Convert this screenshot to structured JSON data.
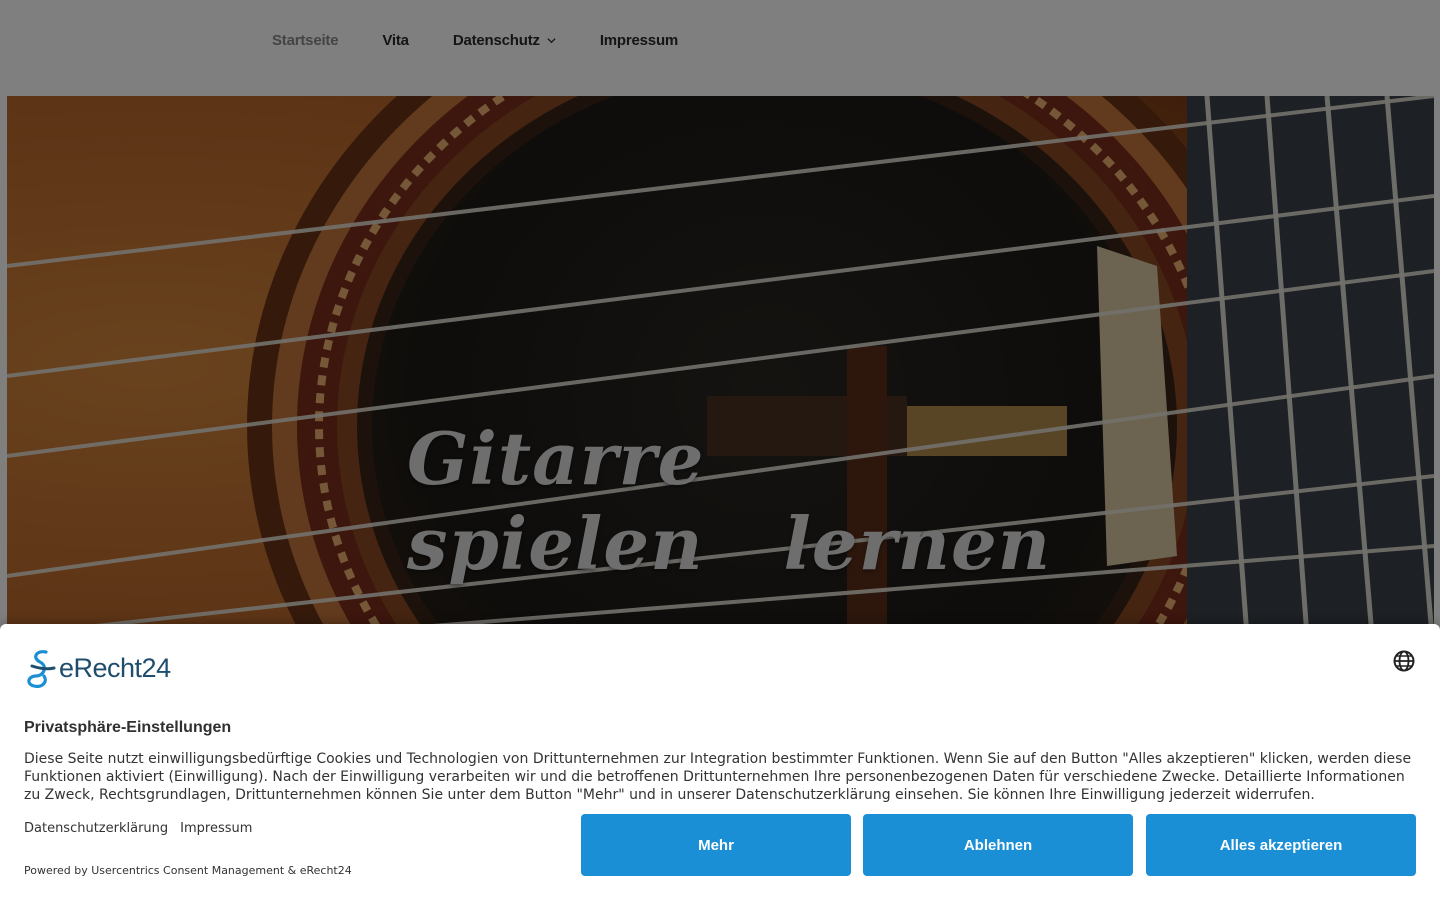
{
  "nav": {
    "items": [
      {
        "label": "Startseite",
        "active": true
      },
      {
        "label": "Vita",
        "active": false
      },
      {
        "label": "Datenschutz",
        "active": false,
        "has_dropdown": true
      },
      {
        "label": "Impressum",
        "active": false
      }
    ]
  },
  "hero": {
    "title_part1": "Gitarre spielen",
    "title_part2": "lernen"
  },
  "consent": {
    "brand": "eRecht24",
    "title": "Privatsphäre-Einstellungen",
    "text": "Diese Seite nutzt einwilligungsbedürftige Cookies und Technologien von Drittunternehmen zur Integration bestimmter Funktionen. Wenn Sie auf den Button \"Alles akzeptieren\" klicken, werden diese Funktionen aktiviert (Einwilligung). Nach der Einwilligung verarbeiten wir und die betroffenen Drittunternehmen Ihre personenbezogenen Daten für verschiedene Zwecke. Detaillierte Informationen zu Zweck, Rechtsgrundlagen, Drittunternehmen können Sie unter dem Button \"Mehr\" und in unserer Datenschutzerklärung einsehen. Sie können Ihre Einwilligung jederzeit widerrufen.",
    "link_privacy": "Datenschutzerklärung",
    "link_imprint": "Impressum",
    "powered_by": "Powered by Usercentrics Consent Management & eRecht24",
    "btn_more": "Mehr",
    "btn_decline": "Ablehnen",
    "btn_accept": "Alles akzeptieren",
    "accent_color": "#1a8fd6"
  },
  "icons": {
    "dropdown": "chevron-down-icon",
    "language": "globe-icon",
    "brand": "erecht24-logo-icon"
  }
}
